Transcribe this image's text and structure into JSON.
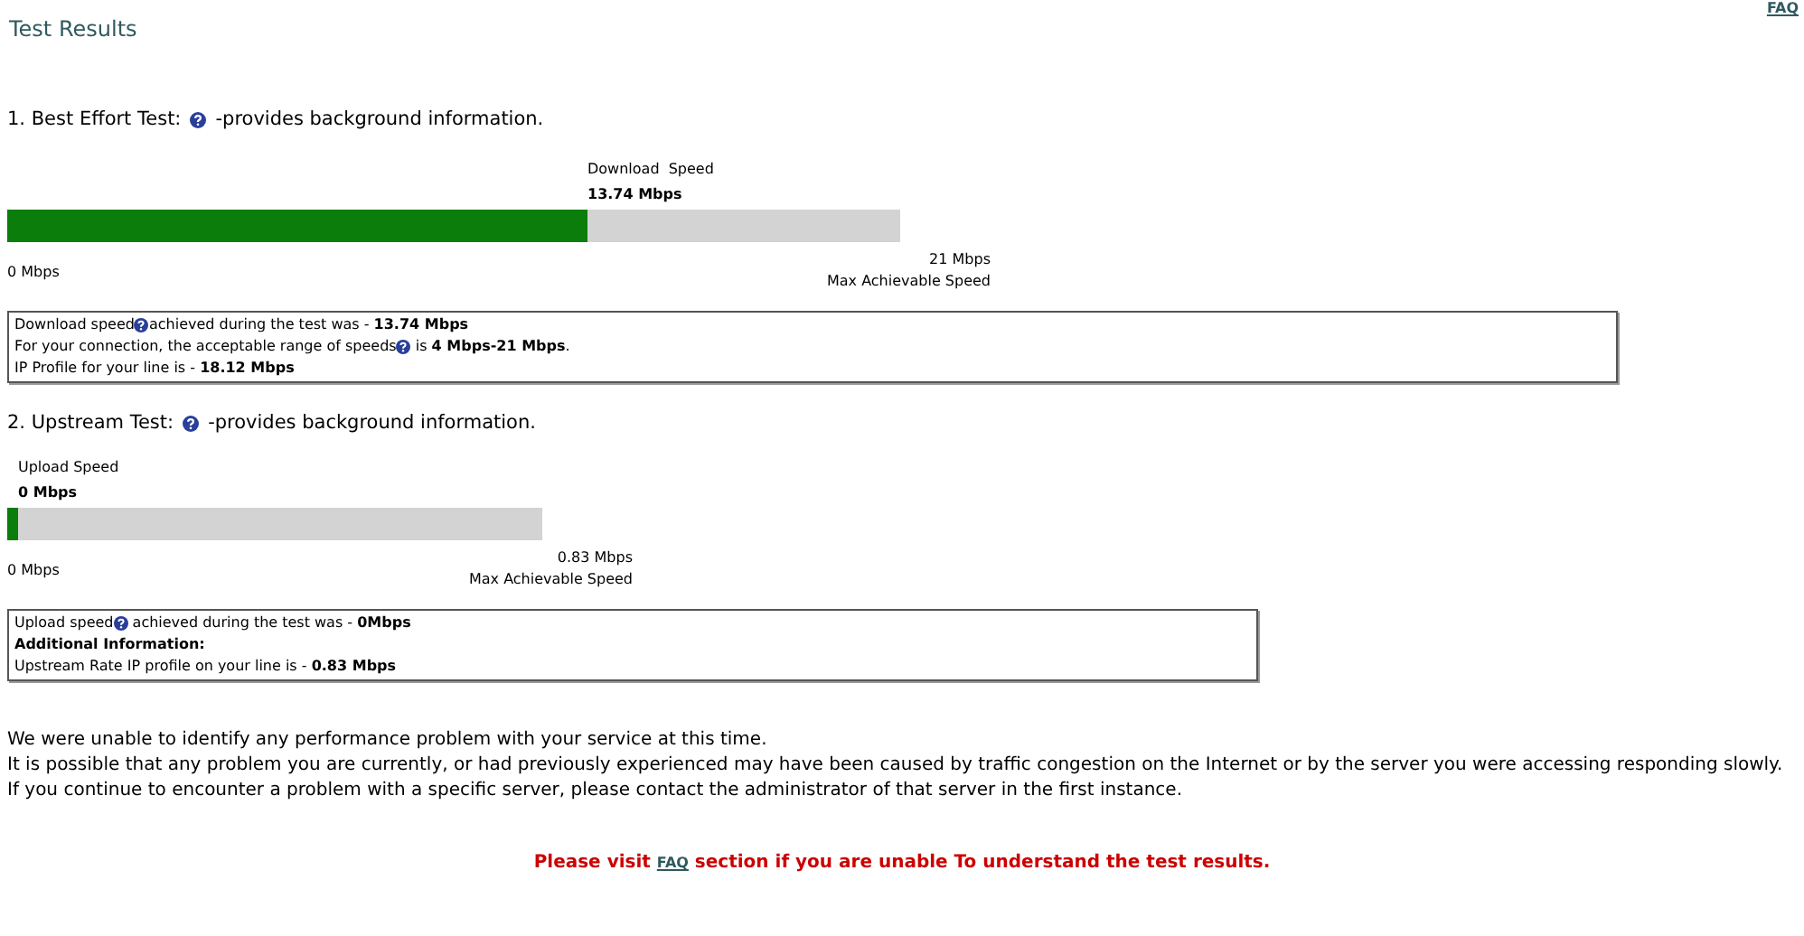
{
  "title": "Test Results",
  "faq_link": "FAQ",
  "sections": [
    {
      "number": "1. Best Effort Test:",
      "suffix": "-provides background information.",
      "gauge": {
        "label": "Download  Speed",
        "value": "13.74 Mbps",
        "level": 0.65,
        "min": "0 Mbps",
        "max": "21 Mbps",
        "max_caption": "Max Achievable Speed"
      },
      "info": [
        {
          "kind": "text",
          "text": "Download speed",
          "help_icon": true,
          "after": "achieved during the test was - **13.74 Mbps**"
        },
        {
          "kind": "text",
          "text": "For your connection, the acceptable range of speeds",
          "help_icon": true,
          "after": " is **4 Mbps-21 Mbps**."
        },
        {
          "kind": "text",
          "text": "IP Profile for your line is - **18.12 Mbps**",
          "help_icon": false
        }
      ]
    },
    {
      "number": "2. Upstream Test:",
      "suffix": "-provides background information.",
      "gauge": {
        "label": "Upload Speed",
        "value": "0 Mbps",
        "level": 0.02,
        "min": "0 Mbps",
        "max": "0.83 Mbps",
        "max_caption": "Max Achievable Speed"
      },
      "info": [
        {
          "kind": "text",
          "text": "Upload speed",
          "help_icon": true,
          "after": " achieved during the test was - **0Mbps**"
        },
        {
          "kind": "subheading",
          "text": "Additional Information:",
          "help_icon": false
        },
        {
          "kind": "text",
          "text": "Upstream Rate IP profile on your line is - **0.83 Mbps**",
          "help_icon": false
        }
      ]
    }
  ],
  "paragraphs": [
    "We were unable to identify any performance problem with your service at this time.",
    "It is possible that any problem you are currently, or had previously experienced may have been caused by traffic congestion on the Internet or by the server you were accessing responding slowly.",
    "If you continue to encounter a problem with a specific server, please contact the administrator of that server in the first instance."
  ],
  "notice": {
    "before": "Please visit ",
    "link": "FAQ",
    "after": " section if you are unable To understand the test results."
  }
}
